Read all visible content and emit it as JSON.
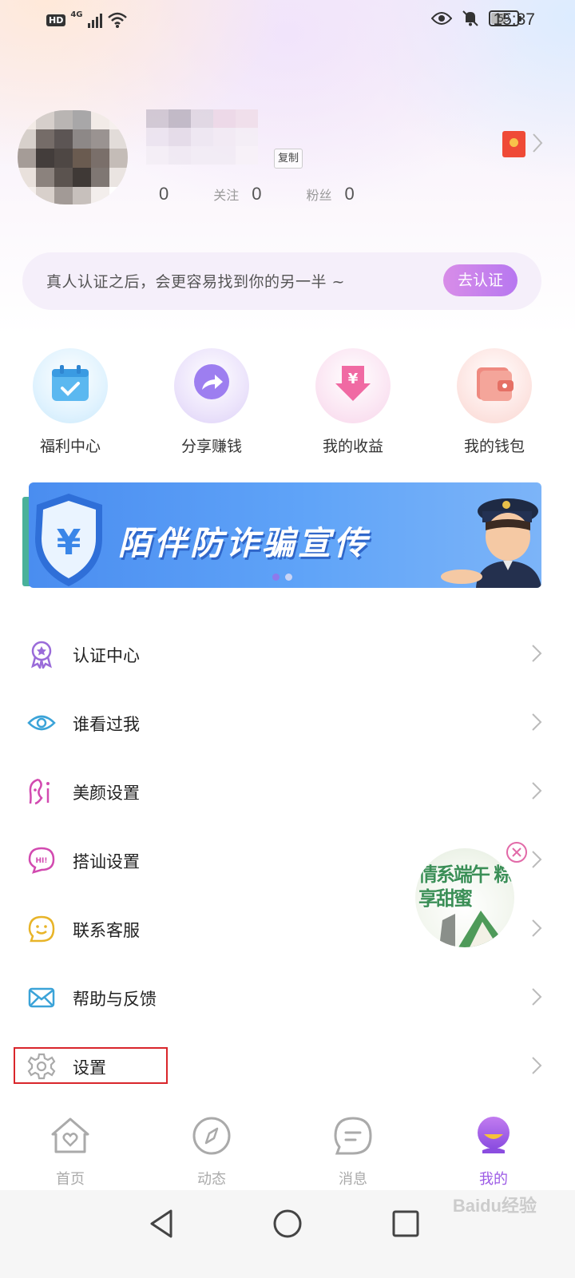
{
  "status_bar": {
    "hd": "HD",
    "network": "4G",
    "battery": "59",
    "battery_level": 0.59,
    "time": "15:37"
  },
  "profile": {
    "copy_label": "复制",
    "stats": [
      {
        "label": "",
        "value": "0"
      },
      {
        "label": "关注",
        "value": "0"
      },
      {
        "label": "粉丝",
        "value": "0"
      }
    ]
  },
  "verify": {
    "text": "真人认证之后，会更容易找到你的另一半 ~",
    "button": "去认证"
  },
  "quick_actions": [
    {
      "label": "福利中心",
      "icon": "calendar-check-icon"
    },
    {
      "label": "分享赚钱",
      "icon": "share-arrow-icon"
    },
    {
      "label": "我的收益",
      "icon": "yuan-down-arrow-icon"
    },
    {
      "label": "我的钱包",
      "icon": "wallet-icon"
    }
  ],
  "banner": {
    "title": "陌伴防诈骗宣传",
    "dots": 2,
    "active_dot": 0
  },
  "menu": [
    {
      "label": "认证中心",
      "icon": "badge-icon"
    },
    {
      "label": "谁看过我",
      "icon": "eye-icon"
    },
    {
      "label": "美颜设置",
      "icon": "face-icon"
    },
    {
      "label": "搭讪设置",
      "icon": "chat-bubble-icon"
    },
    {
      "label": "联系客服",
      "icon": "smile-icon"
    },
    {
      "label": "帮助与反馈",
      "icon": "mail-icon"
    },
    {
      "label": "设置",
      "icon": "gear-icon"
    }
  ],
  "float_promo": {
    "text": "情系端午 粽享甜蜜"
  },
  "tabs": [
    {
      "label": "首页",
      "icon": "home-icon",
      "active": false
    },
    {
      "label": "动态",
      "icon": "compass-icon",
      "active": false
    },
    {
      "label": "消息",
      "icon": "message-icon",
      "active": false
    },
    {
      "label": "我的",
      "icon": "profile-icon",
      "active": true
    }
  ],
  "watermark": "Baidu经验",
  "colors": {
    "accent": "#9c5ae6",
    "highlight": "#d9262b"
  }
}
